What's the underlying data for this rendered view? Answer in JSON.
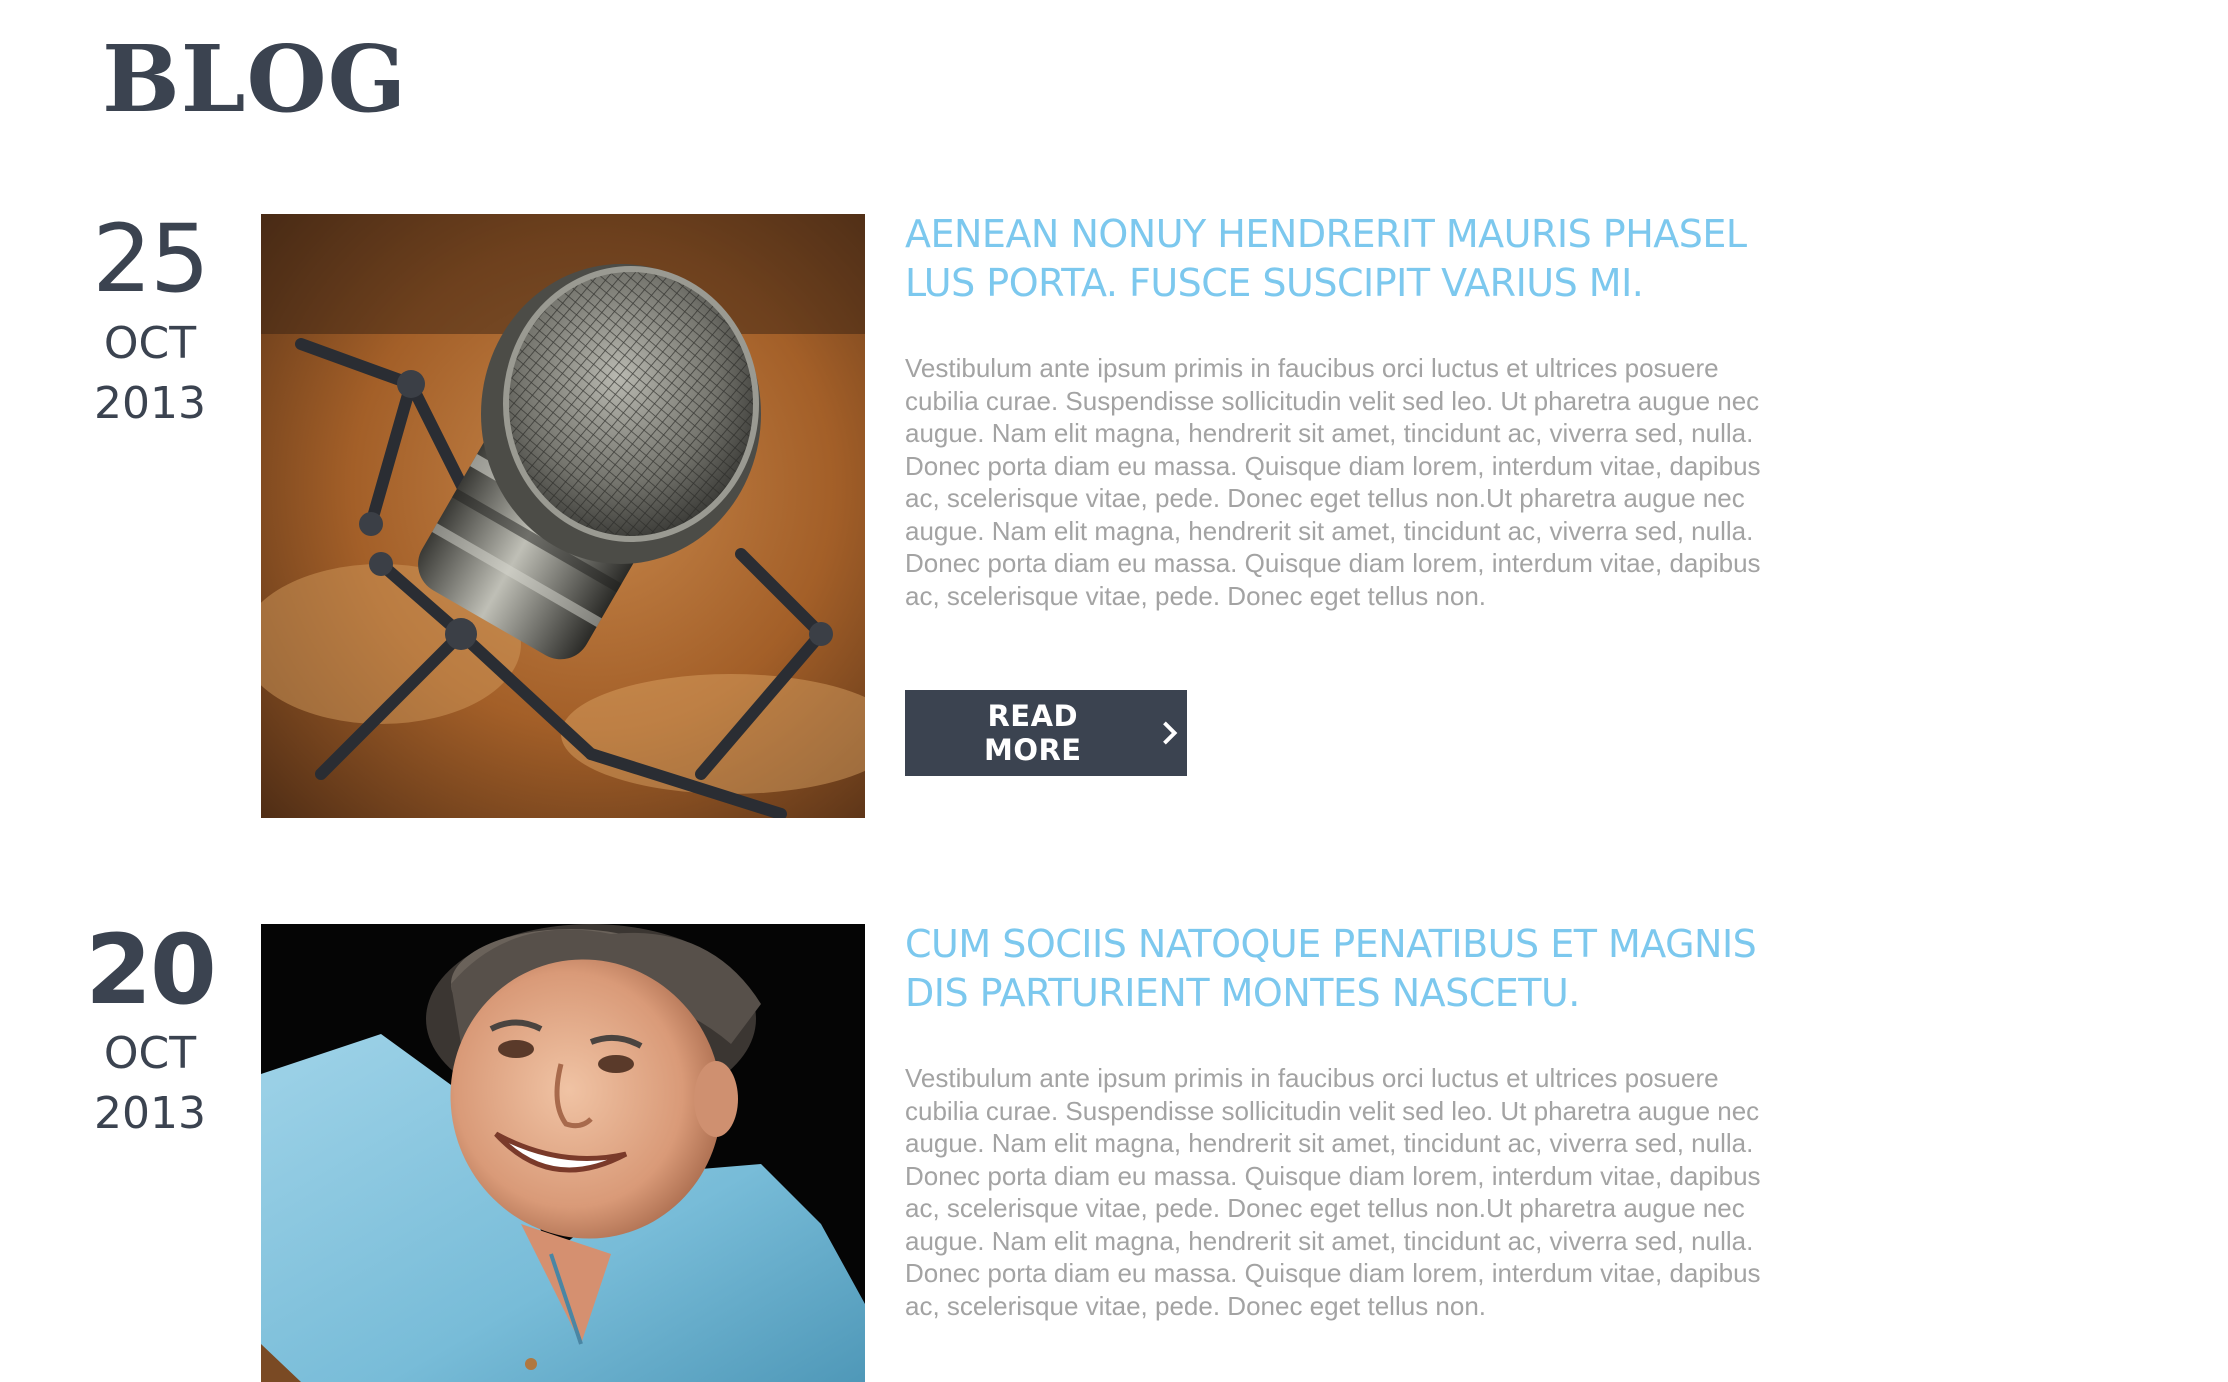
{
  "page": {
    "title": "BLOG"
  },
  "posts": [
    {
      "day": "25",
      "month": "OCT",
      "year": "2013",
      "image": "microphone-photo",
      "title_lines": [
        "AENEAN NONUY HENDRERIT MAURIS PHASEL",
        "LUS PORTA. FUSCE SUSCIPIT VARIUS MI."
      ],
      "excerpt_lines": [
        "Vestibulum ante ipsum primis in faucibus orci luctus et ultrices posuere",
        "cubilia curae. Suspendisse sollicitudin velit sed leo. Ut pharetra augue nec",
        "augue. Nam elit magna, hendrerit sit amet, tincidunt ac, viverra sed, nulla.",
        "Donec porta diam eu massa. Quisque diam lorem, interdum vitae, dapibus",
        "ac, scelerisque vitae, pede. Donec eget tellus non.Ut pharetra augue nec",
        "augue. Nam elit magna, hendrerit sit amet, tincidunt ac, viverra sed, nulla.",
        "Donec porta diam eu massa. Quisque diam lorem, interdum vitae, dapibus",
        "ac, scelerisque vitae, pede. Donec eget tellus non."
      ],
      "button_label": "READ MORE",
      "button_icon": "chevron-right-icon"
    },
    {
      "day": "20",
      "month": "OCT",
      "year": "2013",
      "image": "smiling-man-photo",
      "title_lines": [
        "CUM SOCIIS NATOQUE PENATIBUS ET MAGNIS",
        "DIS PARTURIENT MONTES NASCETU."
      ],
      "excerpt_lines": [
        "Vestibulum ante ipsum primis in faucibus orci luctus et ultrices posuere",
        "cubilia curae. Suspendisse sollicitudin velit sed leo. Ut pharetra augue nec",
        "augue. Nam elit magna, hendrerit sit amet, tincidunt ac, viverra sed, nulla.",
        "Donec porta diam eu massa. Quisque diam lorem, interdum vitae, dapibus",
        "ac, scelerisque vitae, pede. Donec eget tellus non.Ut pharetra augue nec",
        "augue. Nam elit magna, hendrerit sit amet, tincidunt ac, viverra sed, nulla.",
        "Donec porta diam eu massa. Quisque diam lorem, interdum vitae, dapibus",
        "ac, scelerisque vitae, pede. Donec eget tellus non."
      ]
    }
  ],
  "colors": {
    "title_dark": "#3b4350",
    "link_blue": "#7cc8ee",
    "body_gray": "#a3a3a3",
    "button_bg": "#3b4350"
  }
}
